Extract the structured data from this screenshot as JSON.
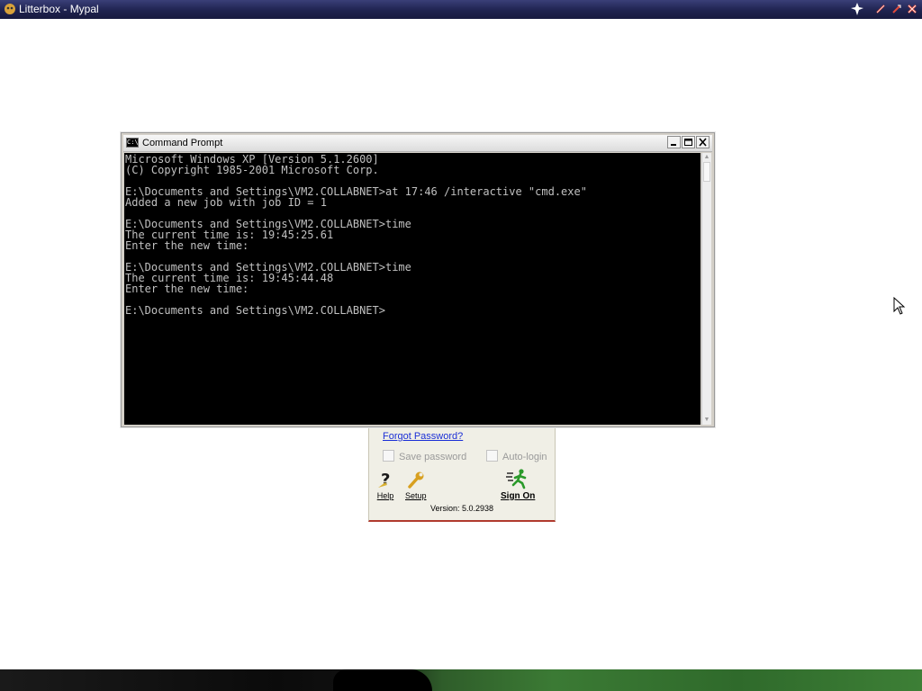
{
  "app": {
    "title": "Litterbox - Mypal"
  },
  "cmd_window": {
    "title": "Command Prompt",
    "icon_text": "C:\\",
    "lines": [
      "Microsoft Windows XP [Version 5.1.2600]",
      "(C) Copyright 1985-2001 Microsoft Corp.",
      "",
      "E:\\Documents and Settings\\VM2.COLLABNET>at 17:46 /interactive \"cmd.exe\"",
      "Added a new job with job ID = 1",
      "",
      "E:\\Documents and Settings\\VM2.COLLABNET>time",
      "The current time is: 19:45:25.61",
      "Enter the new time:",
      "",
      "E:\\Documents and Settings\\VM2.COLLABNET>time",
      "The current time is: 19:45:44.48",
      "Enter the new time:",
      "",
      "E:\\Documents and Settings\\VM2.COLLABNET>"
    ]
  },
  "login_panel": {
    "forgot_password": "Forgot Password?",
    "save_password": "Save password",
    "auto_login": "Auto-login",
    "help_label": "Help",
    "setup_label": "Setup",
    "signon_label": "Sign On",
    "version": "Version: 5.0.2938"
  },
  "colors": {
    "console_bg": "#000000",
    "console_text": "#c0c0c0",
    "link": "#1b2fd6",
    "accent_border": "#b03a2e"
  }
}
